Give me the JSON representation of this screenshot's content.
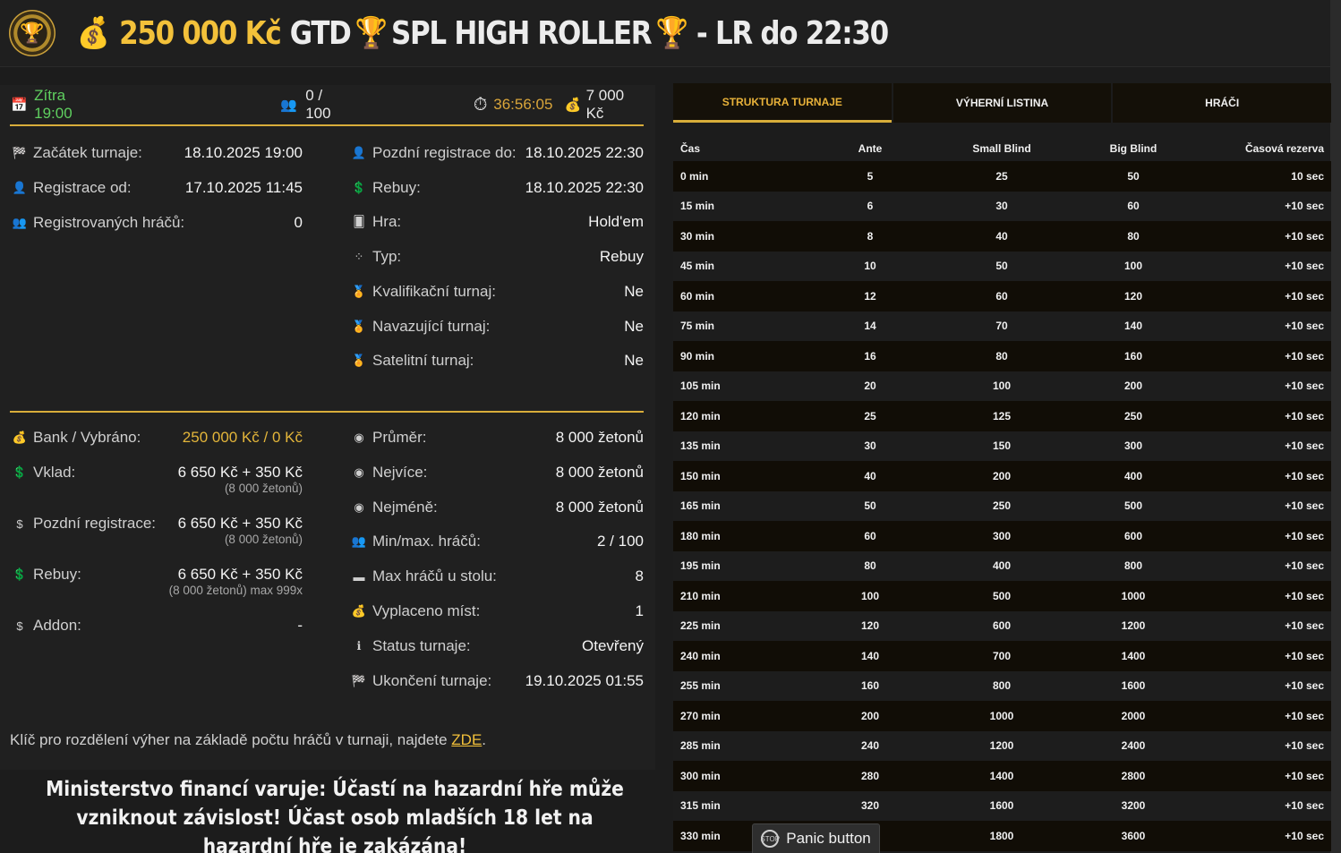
{
  "header": {
    "amount": "250 000 Kč",
    "gtd": "GTD",
    "name": "SPL HIGH ROLLER",
    "suffix": "- LR do 22:30"
  },
  "summary": {
    "date": "Zítra 19:00",
    "players": "0 / 100",
    "countdown": "36:56:05",
    "prize": "7 000 Kč"
  },
  "left_details": [
    {
      "icon": "flag-icon",
      "label": "Začátek turnaje:",
      "value": "18.10.2025 19:00"
    },
    {
      "icon": "user-icon",
      "label": "Registrace od:",
      "value": "17.10.2025 11:45"
    },
    {
      "icon": "users-icon",
      "label": "Registrovaných hráčů:",
      "value": "0"
    }
  ],
  "right_details": [
    {
      "icon": "user-icon",
      "label": "Pozdní registrace do:",
      "value": "18.10.2025 22:30"
    },
    {
      "icon": "rebuy-icon",
      "label": "Rebuy:",
      "value": "18.10.2025 22:30"
    },
    {
      "icon": "cards-icon",
      "label": "Hra:",
      "value": "Hold'em"
    },
    {
      "icon": "chips-icon",
      "label": "Typ:",
      "value": "Rebuy"
    },
    {
      "icon": "medal-icon",
      "label": "Kvalifikační turnaj:",
      "value": "Ne"
    },
    {
      "icon": "medal-icon",
      "label": "Navazující turnaj:",
      "value": "Ne"
    },
    {
      "icon": "medal-icon",
      "label": "Satelitní turnaj:",
      "value": "Ne"
    }
  ],
  "money": [
    {
      "icon": "bank-icon",
      "label": "Bank / Vybráno:",
      "value": "250 000 Kč / 0 Kč",
      "sub": ""
    },
    {
      "icon": "deposit-icon",
      "label": "Vklad:",
      "value": "6 650 Kč + 350 Kč",
      "sub": "(8 000 žetonů)"
    },
    {
      "icon": "coin-icon",
      "label": "Pozdní registrace:",
      "value": "6 650 Kč + 350 Kč",
      "sub": "(8 000 žetonů)"
    },
    {
      "icon": "deposit-icon",
      "label": "Rebuy:",
      "value": "6 650 Kč + 350 Kč",
      "sub": "(8 000 žetonů) max 999x"
    },
    {
      "icon": "coin-icon",
      "label": "Addon:",
      "value": "-",
      "sub": ""
    }
  ],
  "stats": [
    {
      "icon": "chip-icon",
      "label": "Průměr:",
      "value": "8 000 žetonů"
    },
    {
      "icon": "chip-icon",
      "label": "Nejvíce:",
      "value": "8 000 žetonů"
    },
    {
      "icon": "chip-icon",
      "label": "Nejméně:",
      "value": "8 000 žetonů"
    },
    {
      "icon": "users-icon",
      "label": "Min/max. hráčů:",
      "value": "2 / 100"
    },
    {
      "icon": "table-icon",
      "label": "Max hráčů u stolu:",
      "value": "8"
    },
    {
      "icon": "payout-icon",
      "label": "Vyplaceno míst:",
      "value": "1"
    },
    {
      "icon": "info-icon",
      "label": "Status turnaje:",
      "value": "Otevřený"
    },
    {
      "icon": "flag-icon",
      "label": "Ukončení turnaje:",
      "value": "19.10.2025 01:55"
    }
  ],
  "note": {
    "text": "Klíč pro rozdělení výher na základě počtu hráčů v turnaji, najdete ",
    "link": "ZDE",
    "end": "."
  },
  "warning": "Ministerstvo financí varuje: Účastí na hazardní hře může vzniknout závislost! Účast osob mladších 18 let na hazardní hře je zakázána!",
  "tabs": [
    "STRUKTURA TURNAJE",
    "VÝHERNÍ LISTINA",
    "HRÁČI"
  ],
  "table": {
    "headers": [
      "Čas",
      "Ante",
      "Small Blind",
      "Big Blind",
      "Časová rezerva"
    ],
    "rows": [
      [
        "0 min",
        "5",
        "25",
        "50",
        "10 sec"
      ],
      [
        "15 min",
        "6",
        "30",
        "60",
        "+10 sec"
      ],
      [
        "30 min",
        "8",
        "40",
        "80",
        "+10 sec"
      ],
      [
        "45 min",
        "10",
        "50",
        "100",
        "+10 sec"
      ],
      [
        "60 min",
        "12",
        "60",
        "120",
        "+10 sec"
      ],
      [
        "75 min",
        "14",
        "70",
        "140",
        "+10 sec"
      ],
      [
        "90 min",
        "16",
        "80",
        "160",
        "+10 sec"
      ],
      [
        "105 min",
        "20",
        "100",
        "200",
        "+10 sec"
      ],
      [
        "120 min",
        "25",
        "125",
        "250",
        "+10 sec"
      ],
      [
        "135 min",
        "30",
        "150",
        "300",
        "+10 sec"
      ],
      [
        "150 min",
        "40",
        "200",
        "400",
        "+10 sec"
      ],
      [
        "165 min",
        "50",
        "250",
        "500",
        "+10 sec"
      ],
      [
        "180 min",
        "60",
        "300",
        "600",
        "+10 sec"
      ],
      [
        "195 min",
        "80",
        "400",
        "800",
        "+10 sec"
      ],
      [
        "210 min",
        "100",
        "500",
        "1000",
        "+10 sec"
      ],
      [
        "225 min",
        "120",
        "600",
        "1200",
        "+10 sec"
      ],
      [
        "240 min",
        "140",
        "700",
        "1400",
        "+10 sec"
      ],
      [
        "255 min",
        "160",
        "800",
        "1600",
        "+10 sec"
      ],
      [
        "270 min",
        "200",
        "1000",
        "2000",
        "+10 sec"
      ],
      [
        "285 min",
        "240",
        "1200",
        "2400",
        "+10 sec"
      ],
      [
        "300 min",
        "280",
        "1400",
        "2800",
        "+10 sec"
      ],
      [
        "315 min",
        "320",
        "1600",
        "3200",
        "+10 sec"
      ],
      [
        "330 min",
        "",
        "1800",
        "3600",
        "+10 sec"
      ]
    ]
  },
  "panic_button": "Panic button"
}
